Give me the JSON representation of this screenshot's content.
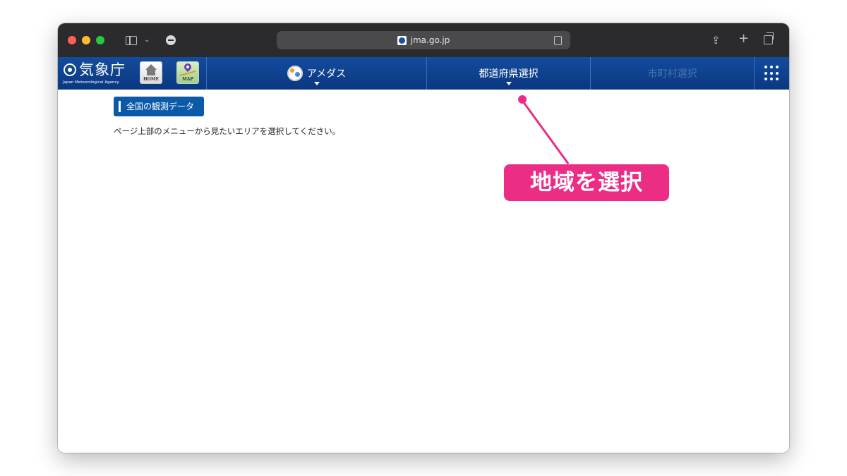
{
  "browser": {
    "url": "jma.go.jp"
  },
  "site": {
    "logo_name": "気象庁",
    "logo_subtitle": "Japan Meteorological Agency",
    "home_label": "HOME",
    "map_label": "MAP"
  },
  "nav": {
    "items": [
      {
        "label": "アメダス",
        "state": "active",
        "icon": "amedas-icon"
      },
      {
        "label": "都道府県選択",
        "state": "active"
      },
      {
        "label": "市町村選択",
        "state": "disabled"
      }
    ],
    "menu_icon": "grid-menu-icon"
  },
  "main": {
    "section_title": "全国の観測データ",
    "instruction": "ページ上部のメニューから見たいエリアを選択してください。"
  },
  "annotation": {
    "label": "地域を選択",
    "color": "#ec2d86"
  },
  "colors": {
    "nav_bg": "#134c9d",
    "badge_bg": "#0b5aa8",
    "titlebar": "#2b2b2d"
  }
}
